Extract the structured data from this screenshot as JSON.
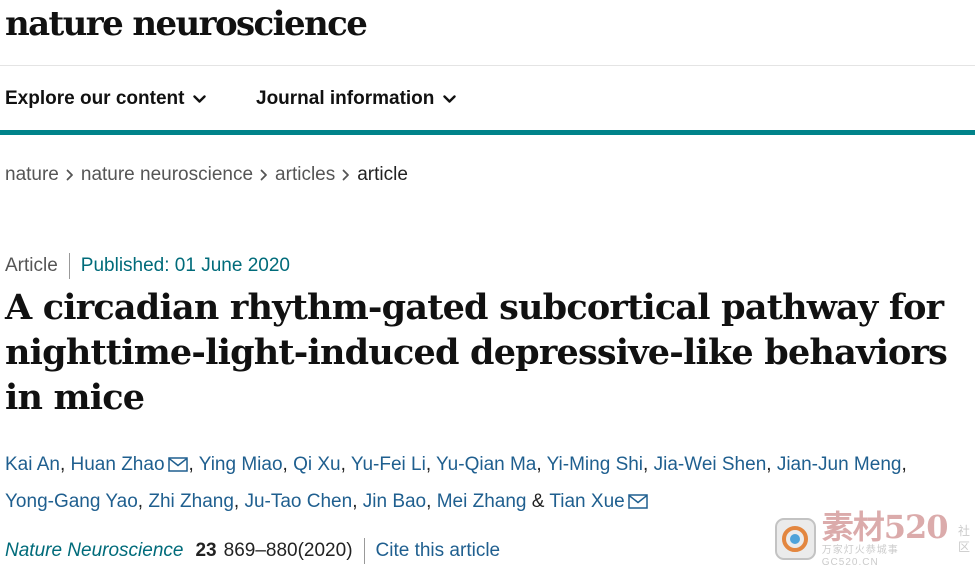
{
  "header": {
    "logo_text": "nature neuroscience"
  },
  "nav": {
    "items": [
      {
        "label": "Explore our content"
      },
      {
        "label": "Journal information"
      }
    ]
  },
  "breadcrumb": {
    "items": [
      "nature",
      "nature neuroscience",
      "articles",
      "article"
    ]
  },
  "article": {
    "type": "Article",
    "published": "Published: 01 June 2020",
    "title": "A circadian rhythm-gated subcortical pathway for nighttime-light-induced depressive-like behaviors in mice",
    "authors": [
      "Kai An",
      "Huan Zhao",
      "Ying Miao",
      "Qi Xu",
      "Yu-Fei Li",
      "Yu-Qian Ma",
      "Yi-Ming Shi",
      "Jia-Wei Shen",
      "Jian-Jun Meng",
      "Yong-Gang Yao",
      "Zhi Zhang",
      "Ju-Tao Chen",
      "Jin Bao",
      "Mei Zhang",
      "Tian Xue"
    ],
    "author_separator": ", ",
    "author_last_separator": " & ",
    "journal": "Nature Neuroscience",
    "volume": "23",
    "pages": "869–880(2020)",
    "cite_label": "Cite this article"
  },
  "watermark": {
    "main": "素材520",
    "sub": "万家灯火恭城事 GC520.CN",
    "side": [
      "社",
      "区"
    ]
  },
  "colors": {
    "accent_teal": "#00838a",
    "link_blue": "#1f5f8f",
    "meta_teal": "#006b7a"
  },
  "icons": {
    "nav_chevron": "chevron-down-icon",
    "breadcrumb_sep": "chevron-right-icon",
    "author_mail": "mail-icon"
  }
}
